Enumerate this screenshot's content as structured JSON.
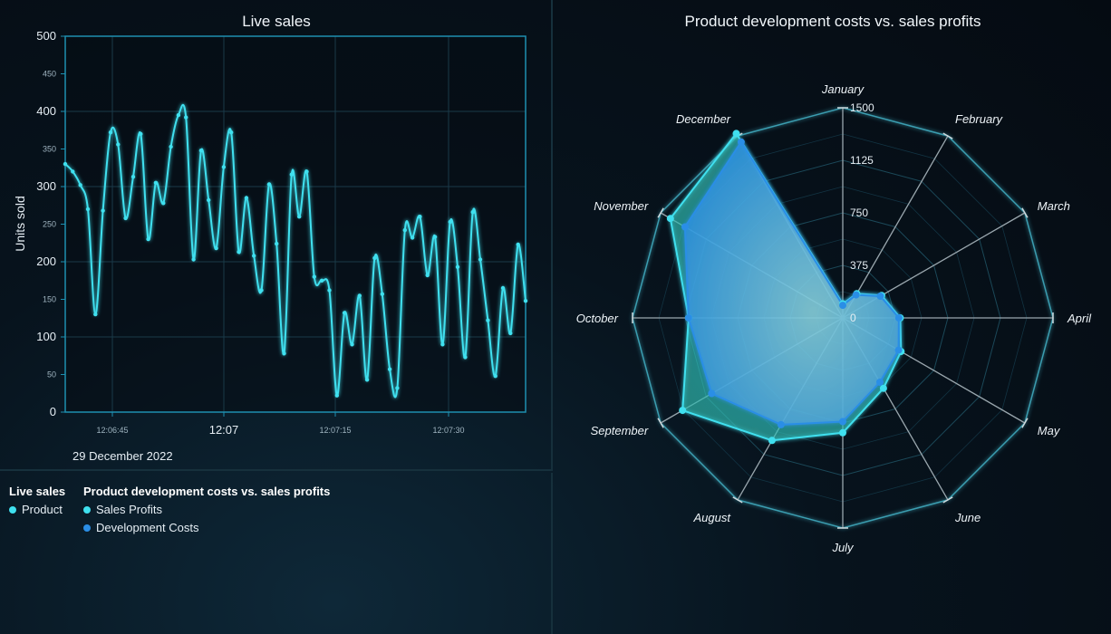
{
  "colors": {
    "line": "#3fe0ef",
    "profits": "#3fe0ef",
    "costs": "#2a8ee6",
    "grid": "#1a3a48",
    "axis": "#1e8fb0"
  },
  "legend": {
    "group1_title": "Live sales",
    "group1_items": [
      "Product"
    ],
    "group2_title": "Product development costs vs. sales profits",
    "group2_items": [
      "Sales Profits",
      "Development Costs"
    ]
  },
  "chart_data": [
    {
      "type": "line",
      "title": "Live sales",
      "ylabel": "Units sold",
      "xlabel": "",
      "date_label": "29 December 2022",
      "x_ticks": [
        "12:06:45",
        "12:07",
        "12:07:15",
        "12:07:30"
      ],
      "x_major_tick": "12:07",
      "y_ticks": [
        0,
        50,
        100,
        150,
        200,
        250,
        300,
        350,
        400,
        450,
        500
      ],
      "ylim": [
        0,
        500
      ],
      "grid": true,
      "series": [
        {
          "name": "Product",
          "values": [
            330,
            320,
            302,
            270,
            130,
            268,
            372,
            356,
            258,
            313,
            370,
            230,
            305,
            278,
            353,
            395,
            392,
            203,
            348,
            282,
            218,
            326,
            372,
            213,
            285,
            208,
            162,
            303,
            224,
            78,
            316,
            260,
            320,
            180,
            175,
            162,
            22,
            132,
            90,
            155,
            43,
            205,
            157,
            57,
            32,
            242,
            232,
            260,
            182,
            233,
            90,
            253,
            193,
            73,
            266,
            203,
            122,
            48,
            165,
            105,
            223,
            148
          ]
        }
      ]
    },
    {
      "type": "radar",
      "title": "Product development costs vs. sales profits",
      "categories": [
        "January",
        "February",
        "March",
        "April",
        "May",
        "June",
        "July",
        "August",
        "September",
        "October",
        "November",
        "December"
      ],
      "r_ticks": [
        0,
        375,
        750,
        1125,
        1500
      ],
      "rlim": [
        0,
        1500
      ],
      "series": [
        {
          "name": "Sales Profits",
          "values": [
            100,
            200,
            320,
            410,
            480,
            580,
            820,
            1010,
            1320,
            1100,
            1420,
            1520
          ]
        },
        {
          "name": "Development Costs",
          "values": [
            90,
            190,
            310,
            400,
            460,
            530,
            740,
            880,
            1080,
            1100,
            1300,
            1450
          ]
        }
      ]
    }
  ]
}
